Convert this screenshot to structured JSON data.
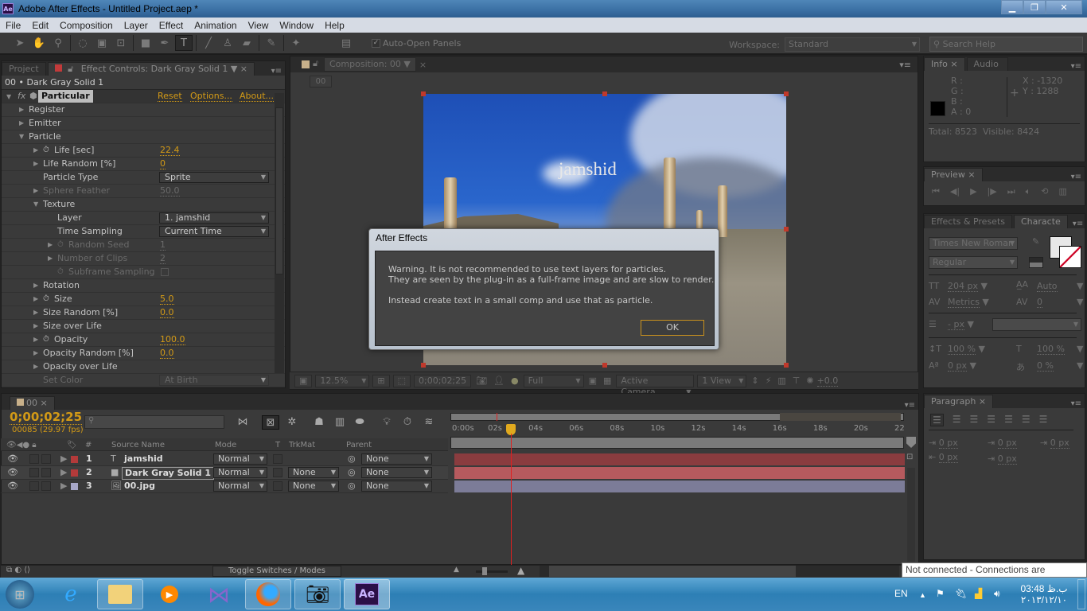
{
  "window": {
    "title": "Adobe After Effects - Untitled Project.aep *",
    "app_badge": "Ae"
  },
  "menu": [
    "File",
    "Edit",
    "Composition",
    "Layer",
    "Effect",
    "Animation",
    "View",
    "Window",
    "Help"
  ],
  "toolbar": {
    "auto_open_panels": "Auto-Open Panels",
    "auto_open_checked": "✓",
    "workspace_label": "Workspace:",
    "workspace_value": "Standard",
    "search_placeholder": "Search Help"
  },
  "project_panel": {
    "tab": "Project"
  },
  "effect_controls": {
    "tab": "Effect Controls: Dark Gray Solid 1",
    "header": "00 • Dark Gray Solid 1",
    "effect_name": "Particular",
    "reset": "Reset",
    "options": "Options...",
    "about": "About...",
    "rows": [
      {
        "label": "Register",
        "indent": 1,
        "tri": "▶"
      },
      {
        "label": "Emitter",
        "indent": 1,
        "tri": "▶"
      },
      {
        "label": "Particle",
        "indent": 1,
        "tri": "▼"
      },
      {
        "label": "Life [sec]",
        "indent": 2,
        "tri": "▶",
        "stopwatch": true,
        "value": "22.4"
      },
      {
        "label": "Life Random [%]",
        "indent": 2,
        "tri": "▶",
        "value": "0"
      },
      {
        "label": "Particle Type",
        "indent": 2,
        "dropdown": "Sprite"
      },
      {
        "label": "Sphere Feather",
        "indent": 2,
        "tri": "▶",
        "value": "50.0",
        "dim": true
      },
      {
        "label": "Texture",
        "indent": 2,
        "tri": "▼"
      },
      {
        "label": "Layer",
        "indent": 3,
        "dropdown": "1. jamshid"
      },
      {
        "label": "Time Sampling",
        "indent": 3,
        "dropdown": "Current Time"
      },
      {
        "label": "Random Seed",
        "indent": 3,
        "tri": "▶",
        "stopwatch": true,
        "value": "1",
        "dim": true
      },
      {
        "label": "Number of Clips",
        "indent": 3,
        "tri": "▶",
        "value": "2",
        "dim": true
      },
      {
        "label": "Subframe Sampling",
        "indent": 3,
        "stopwatch": true,
        "checkbox": true,
        "dim": true
      },
      {
        "label": "Rotation",
        "indent": 2,
        "tri": "▶"
      },
      {
        "label": "Size",
        "indent": 2,
        "tri": "▶",
        "stopwatch": true,
        "value": "5.0"
      },
      {
        "label": "Size Random [%]",
        "indent": 2,
        "tri": "▶",
        "value": "0.0"
      },
      {
        "label": "Size over Life",
        "indent": 2,
        "tri": "▶"
      },
      {
        "label": "Opacity",
        "indent": 2,
        "tri": "▶",
        "stopwatch": true,
        "value": "100.0"
      },
      {
        "label": "Opacity Random [%]",
        "indent": 2,
        "tri": "▶",
        "value": "0.0"
      },
      {
        "label": "Opacity over Life",
        "indent": 2,
        "tri": "▶"
      },
      {
        "label": "Set Color",
        "indent": 2,
        "dropdown": "At Birth",
        "dim": true
      }
    ]
  },
  "composition": {
    "tab": "Composition: 00",
    "breadcrumb": "00",
    "text_layer": "jamshid",
    "zoom": "12.5%",
    "timecode": "0;00;02;25",
    "resolution": "Full",
    "camera": "Active Camera",
    "views": "1 View",
    "exposure": "+0.0"
  },
  "dialog": {
    "title": "After Effects",
    "message": "Warning. It is not recommended to use text layers for particles.\nThey are seen by the plug-in as a full-frame image and are slow to render.\n\nInstead create text in a small comp and use that as particle.",
    "ok": "OK"
  },
  "info": {
    "tab": "Info",
    "tab2": "Audio",
    "r": "R :",
    "g": "G :",
    "b": "B :",
    "a": "A : 0",
    "x": "X : -1320",
    "y": "Y : 1288",
    "total": "Total: 8523",
    "visible": "Visible: 8424"
  },
  "preview": {
    "tab": "Preview"
  },
  "character": {
    "tab1": "Effects & Presets",
    "tab2": "Characte",
    "font": "Times New Roman",
    "style": "Regular",
    "size": "204 px",
    "leading": "Auto",
    "kerning": "Metrics",
    "tracking": "0",
    "stroke": "- px",
    "vscale": "100 %",
    "hscale": "100 %",
    "baseline": "0 px",
    "tsume": "0 %"
  },
  "paragraph": {
    "tab": "Paragraph",
    "indent_left": "0 px",
    "space_before": "0 px",
    "indent_right": "0 px",
    "first_line": "0 px",
    "space_after": "0 px"
  },
  "timeline": {
    "tab": "00",
    "timecode": "0;00;02;25",
    "frames": "00085 (29.97 fps)",
    "search_placeholder": "",
    "columns": {
      "num": "#",
      "source": "Source Name",
      "mode": "Mode",
      "t": "T",
      "trkmat": "TrkMat",
      "parent": "Parent"
    },
    "ticks": [
      "0:00s",
      "02s",
      "04s",
      "06s",
      "08s",
      "10s",
      "12s",
      "14s",
      "16s",
      "18s",
      "20s",
      "22"
    ],
    "current_time_sec": 2.83,
    "work_area_end_sec": 16,
    "layers": [
      {
        "num": "1",
        "name": "jamshid",
        "type": "text",
        "label_color": "#b33a3a",
        "mode": "Normal",
        "trkmat": "",
        "parent": "None",
        "bar_color": "#8a3c3f"
      },
      {
        "num": "2",
        "name": "Dark Gray Solid 1",
        "type": "solid",
        "label_color": "#b33a3a",
        "mode": "Normal",
        "trkmat": "None",
        "parent": "None",
        "bar_color": "#b65a5e",
        "selected": true
      },
      {
        "num": "3",
        "name": "00.jpg",
        "type": "image",
        "label_color": "#a8a8c8",
        "mode": "Normal",
        "trkmat": "None",
        "parent": "None",
        "bar_color": "#7c7c98"
      }
    ],
    "toggle_label": "Toggle Switches / Modes"
  },
  "tooltip": "Not connected - Connections are available",
  "taskbar": {
    "lang": "EN",
    "time": "03:48 ب.ظ",
    "date": "۲۰۱۳/۱۲/۱۰",
    "apps": [
      "start",
      "internet-explorer",
      "file-explorer",
      "media-player",
      "visual-studio",
      "firefox",
      "camera",
      "after-effects"
    ]
  },
  "colors": {
    "accent": "#d39a16",
    "panel": "#3a3a3a",
    "dialog_ok_border": "#c8901e"
  }
}
